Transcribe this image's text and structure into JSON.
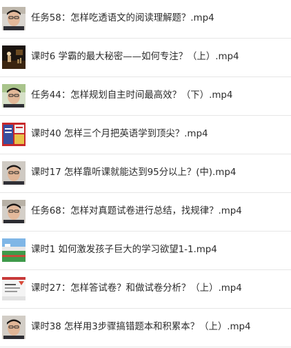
{
  "files": [
    {
      "name": "任务58：怎样吃透语文的阅读理解题？.mp4",
      "icon": "face-video-thumbnail-icon"
    },
    {
      "name": "课时6 学霸的最大秘密——如何专注？（上）.mp4",
      "icon": "stage-video-thumbnail-icon"
    },
    {
      "name": "任务44：怎样规划自主时间最高效？（下）.mp4",
      "icon": "face-video-thumbnail-icon"
    },
    {
      "name": "课时40 怎样三个月把英语学到顶尖？.mp4",
      "icon": "red-poster-video-thumbnail-icon"
    },
    {
      "name": "课时17 怎样靠听课就能达到95分以上？(中).mp4",
      "icon": "face-video-thumbnail-icon"
    },
    {
      "name": "任务68：怎样对真题试卷进行总结，找规律？.mp4",
      "icon": "face-video-thumbnail-icon"
    },
    {
      "name": "课时1 如何激发孩子巨大的学习欲望1-1.mp4",
      "icon": "field-video-thumbnail-icon"
    },
    {
      "name": "课时27：怎样答试卷？和做试卷分析？（上）.mp4",
      "icon": "slide-video-thumbnail-icon"
    },
    {
      "name": "课时38 怎样用3步骤搞错题本和积累本？（上）.mp4",
      "icon": "face-video-thumbnail-icon"
    }
  ]
}
